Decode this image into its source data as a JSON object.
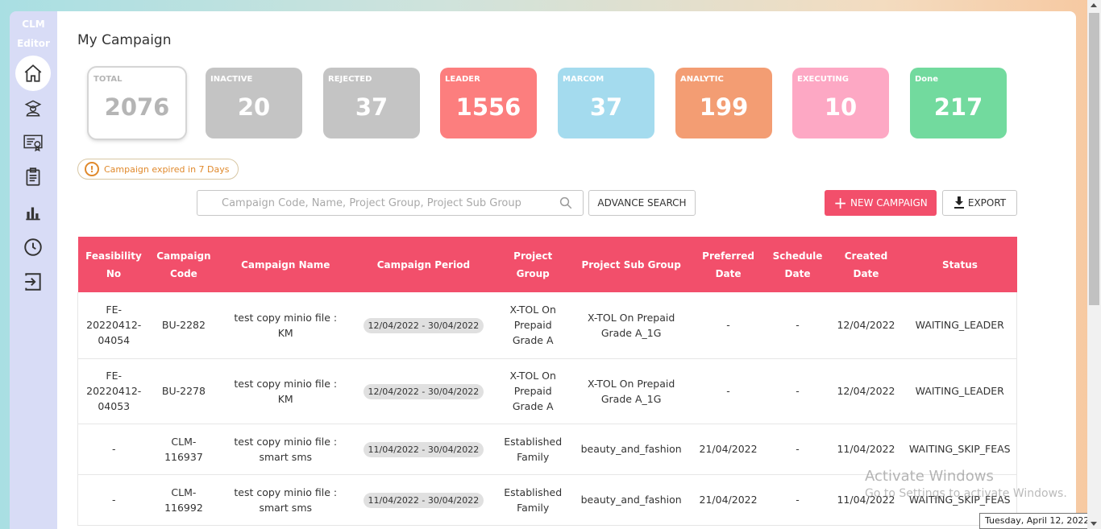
{
  "sidebar": {
    "brand_line1": "CLM",
    "brand_line2": "Editor",
    "items": [
      {
        "icon": "home-icon",
        "active": true
      },
      {
        "icon": "learning-icon",
        "active": false
      },
      {
        "icon": "certificate-icon",
        "active": false
      },
      {
        "icon": "clipboard-icon",
        "active": false
      },
      {
        "icon": "bar-chart-icon",
        "active": false
      },
      {
        "icon": "clock-icon",
        "active": false
      },
      {
        "icon": "logout-icon",
        "active": false
      }
    ]
  },
  "page": {
    "title": "My Campaign"
  },
  "stats": [
    {
      "label": "TOTAL",
      "value": "2076",
      "color": "#ffffff"
    },
    {
      "label": "INACTIVE",
      "value": "20",
      "color": "#c4c4c4"
    },
    {
      "label": "REJECTED",
      "value": "37",
      "color": "#c4c4c4"
    },
    {
      "label": "LEADER",
      "value": "1556",
      "color": "#fc7e7e"
    },
    {
      "label": "MARCOM",
      "value": "37",
      "color": "#a4dbee"
    },
    {
      "label": "ANALYTIC",
      "value": "199",
      "color": "#f39d73"
    },
    {
      "label": "EXECUTING",
      "value": "10",
      "color": "#fda8c4"
    },
    {
      "label": "Done",
      "value": "217",
      "color": "#72da9e"
    }
  ],
  "notice": {
    "text": "Campaign expired in 7 Days"
  },
  "search": {
    "placeholder": "Campaign Code, Name, Project Group, Project Sub Group"
  },
  "toolbar": {
    "advance_search": "ADVANCE SEARCH",
    "new_campaign": "NEW CAMPAIGN",
    "export": "EXPORT"
  },
  "table": {
    "headers": {
      "feasibility_1": "Feasibility",
      "feasibility_2": "No",
      "code_1": "Campaign",
      "code_2": "Code",
      "name": "Campaign Name",
      "period": "Campaign Period",
      "group_1": "Project",
      "group_2": "Group",
      "subgroup": "Project Sub Group",
      "preferred_1": "Preferred",
      "preferred_2": "Date",
      "schedule_1": "Schedule",
      "schedule_2": "Date",
      "created_1": "Created",
      "created_2": "Date",
      "status": "Status"
    },
    "rows": [
      {
        "feas_1": "FE-",
        "feas_2": "20220412-",
        "feas_3": "04054",
        "code_1": "BU-2282",
        "code_2": "",
        "name_1": "test copy minio file :",
        "name_2": "KM",
        "period": "12/04/2022 - 30/04/2022",
        "group_1": "X-TOL On",
        "group_2": "Prepaid",
        "group_3": "Grade A",
        "sub_1": "X-TOL On Prepaid",
        "sub_2": "Grade A_1G",
        "preferred": "-",
        "schedule": "-",
        "created": "12/04/2022",
        "status": "WAITING_LEADER"
      },
      {
        "feas_1": "FE-",
        "feas_2": "20220412-",
        "feas_3": "04053",
        "code_1": "BU-2278",
        "code_2": "",
        "name_1": "test copy minio file :",
        "name_2": "KM",
        "period": "12/04/2022 - 30/04/2022",
        "group_1": "X-TOL On",
        "group_2": "Prepaid",
        "group_3": "Grade A",
        "sub_1": "X-TOL On Prepaid",
        "sub_2": "Grade A_1G",
        "preferred": "-",
        "schedule": "-",
        "created": "12/04/2022",
        "status": "WAITING_LEADER"
      },
      {
        "feas_1": "-",
        "feas_2": "",
        "feas_3": "",
        "code_1": "CLM-",
        "code_2": "116937",
        "name_1": "test copy minio file :",
        "name_2": "smart sms",
        "period": "11/04/2022 - 30/04/2022",
        "group_1": "Established",
        "group_2": "Family",
        "group_3": "",
        "sub_1": "beauty_and_fashion",
        "sub_2": "",
        "preferred": "21/04/2022",
        "schedule": "-",
        "created": "11/04/2022",
        "status": "WAITING_SKIP_FEAS"
      },
      {
        "feas_1": "-",
        "feas_2": "",
        "feas_3": "",
        "code_1": "CLM-",
        "code_2": "116992",
        "name_1": "test copy minio file :",
        "name_2": "smart sms",
        "period": "11/04/2022 - 30/04/2022",
        "group_1": "Established",
        "group_2": "Family",
        "group_3": "",
        "sub_1": "beauty_and_fashion",
        "sub_2": "",
        "preferred": "21/04/2022",
        "schedule": "-",
        "created": "11/04/2022",
        "status": "WAITING_SKIP_FEAS"
      }
    ]
  },
  "overlay": {
    "watermark_title": "Activate Windows",
    "watermark_sub": "Go to Settings to activate Windows.",
    "date_tooltip": "Tuesday, April 12, 2022"
  },
  "colors": {
    "accent": "#f24f6b",
    "notice": "#e0892c",
    "sidebar": "#d8dcf6"
  }
}
